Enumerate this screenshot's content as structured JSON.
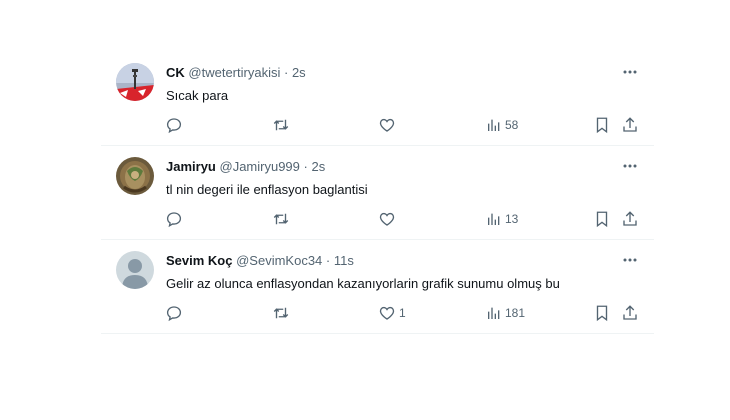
{
  "tweets": [
    {
      "name": "CK",
      "handle": "@twetertiryakisi",
      "sep": "·",
      "time": "2s",
      "text": "Sıcak para",
      "likes": "",
      "views": "58",
      "avatar": "flag-avatar"
    },
    {
      "name": "Jamiryu",
      "handle": "@Jamiryu999",
      "sep": "·",
      "time": "2s",
      "text": "tl nin degeri ile enflasyon baglantisi",
      "likes": "",
      "views": "13",
      "avatar": "photo-avatar"
    },
    {
      "name": "Sevim Koç",
      "handle": "@SevimKoc34",
      "sep": "·",
      "time": "11s",
      "text": "Gelir az olunca enflasyondan kazanıyorlarin grafik sunumu olmuş bu",
      "likes": "1",
      "views": "181",
      "avatar": "default-avatar"
    }
  ],
  "icons": {
    "reply": "reply-icon",
    "retweet": "retweet-icon",
    "like": "heart-icon",
    "views": "views-icon",
    "bookmark": "bookmark-icon",
    "share": "share-icon",
    "more": "more-icon"
  },
  "colors": {
    "text": "#0f1419",
    "secondary": "#536471",
    "border": "#eff3f4"
  }
}
